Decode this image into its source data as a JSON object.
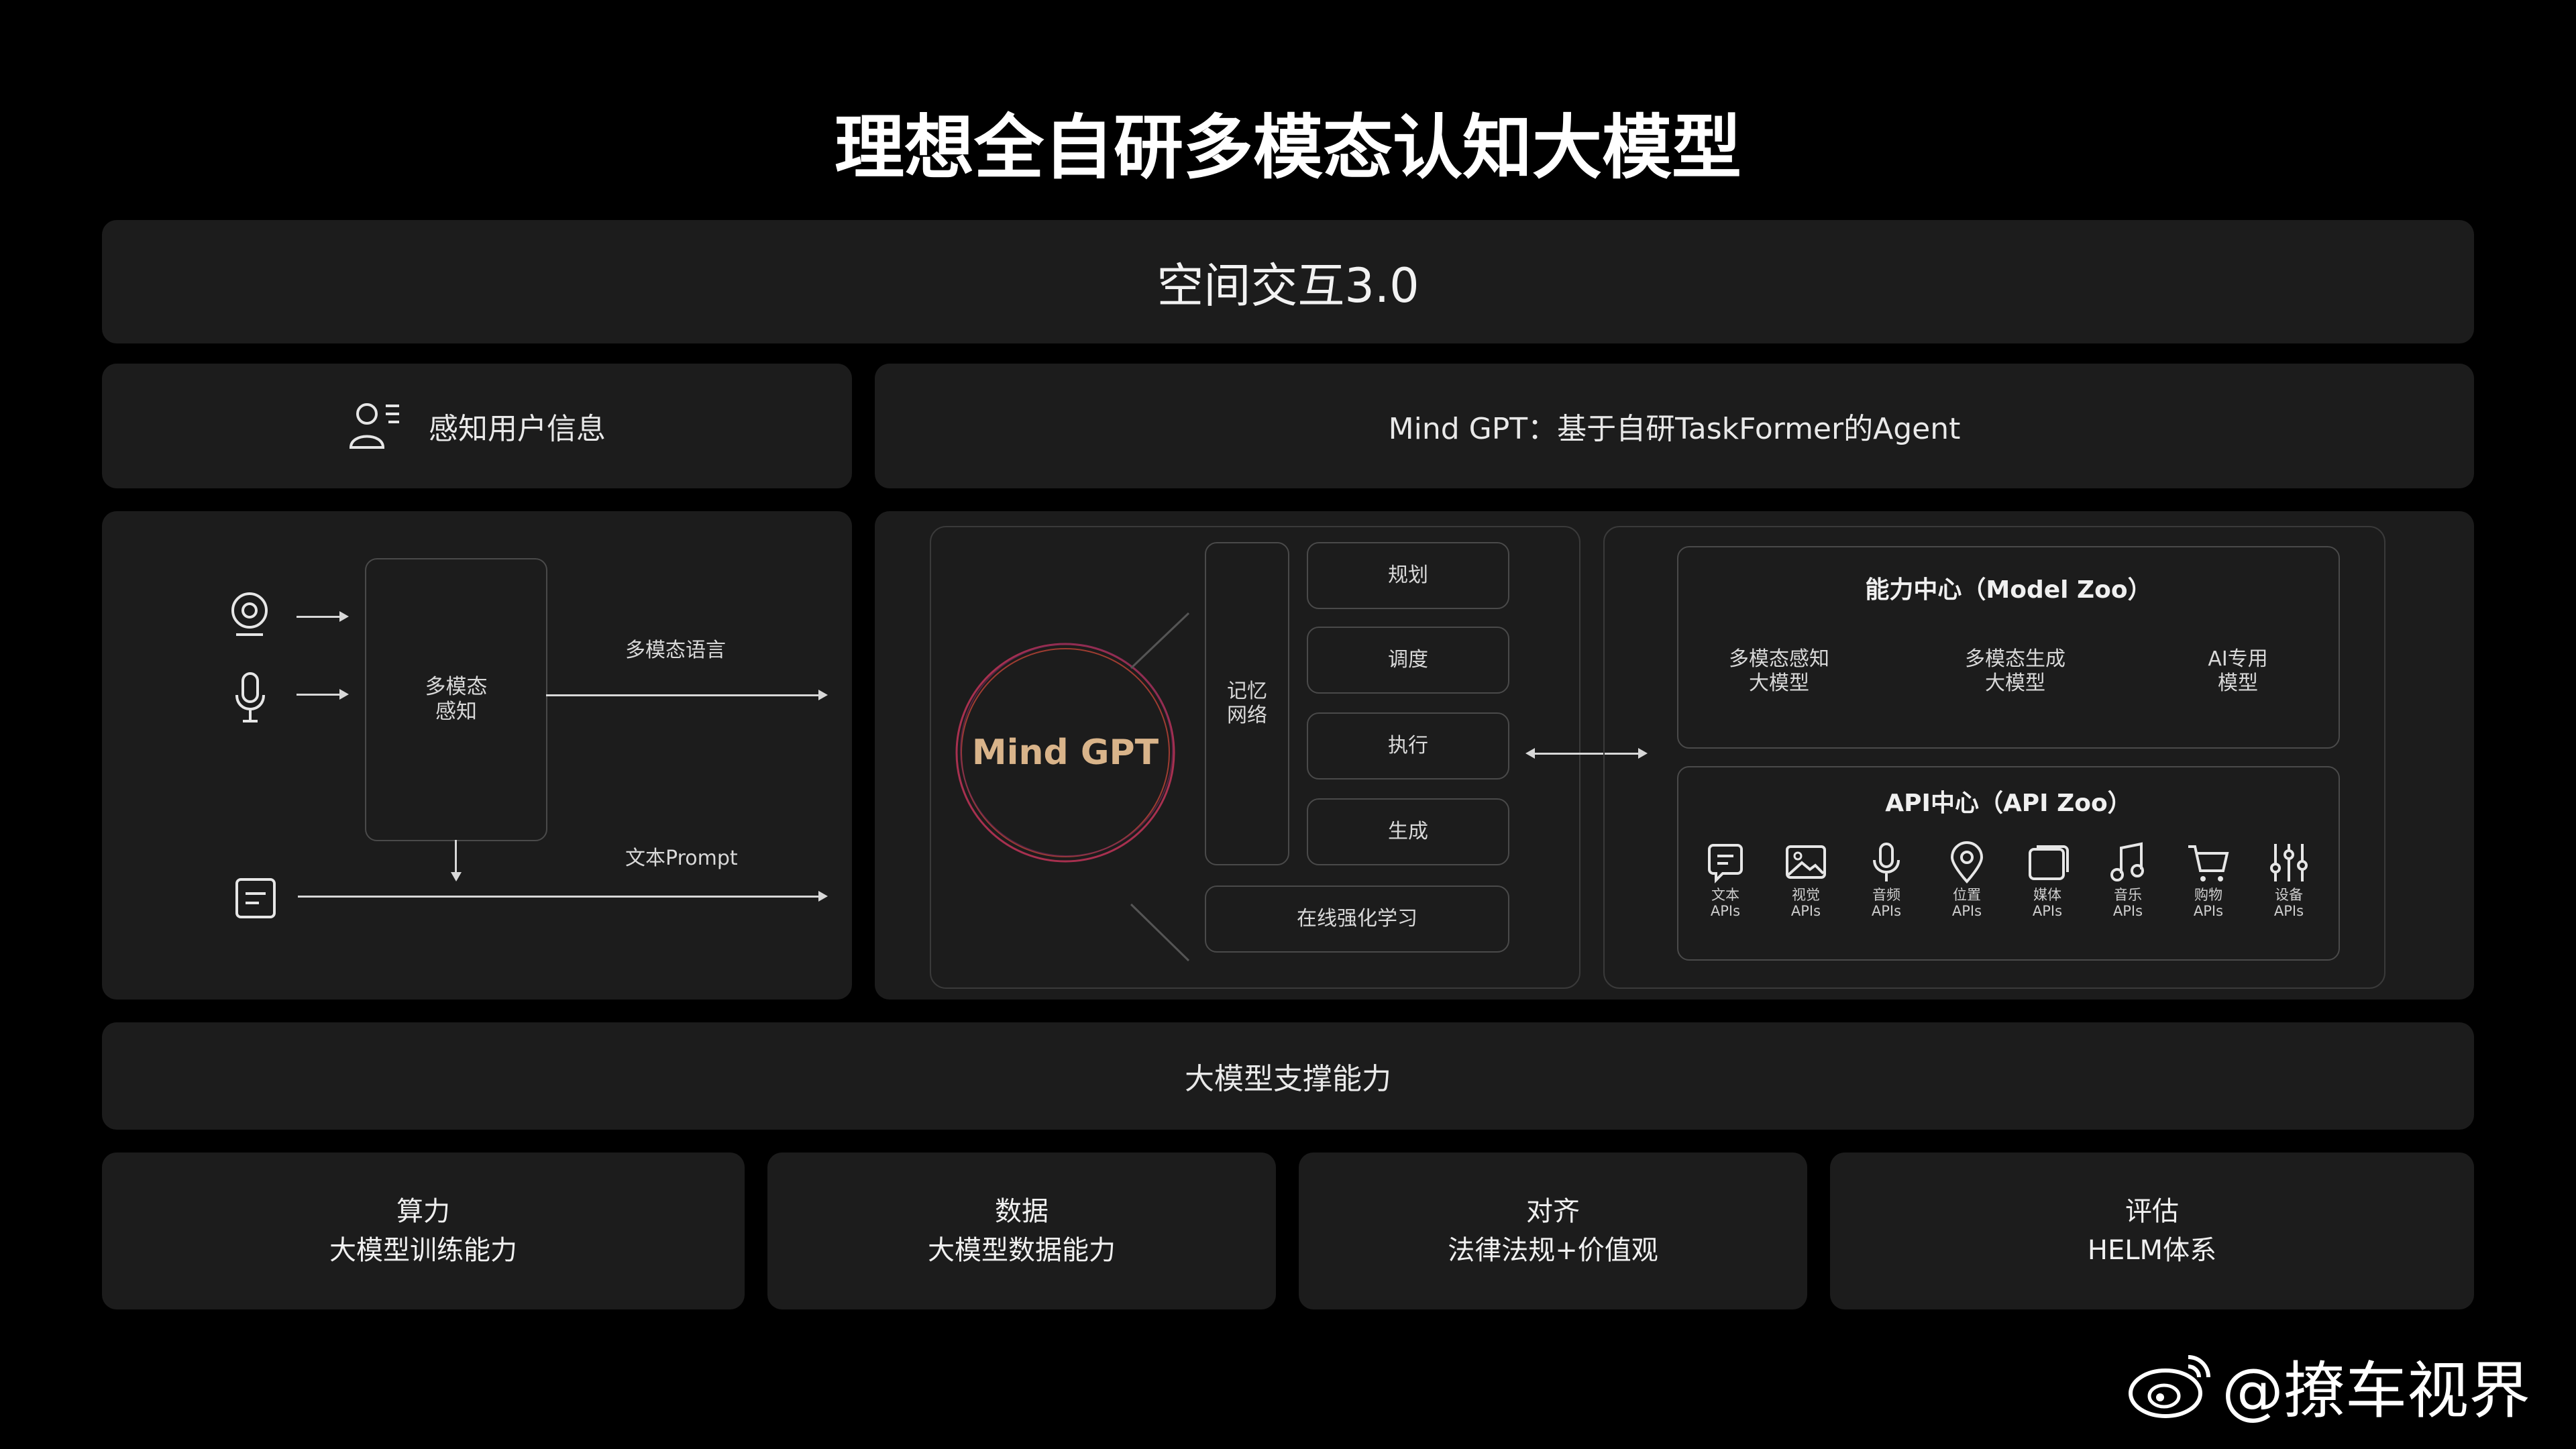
{
  "title": "理想全自研多模态认知大模型",
  "row1": {
    "label": "空间交互3.0"
  },
  "row2": {
    "left_label": "感知用户信息",
    "right_label": "Mind GPT：基于自研TaskFormer的Agent"
  },
  "perception": {
    "box_label_line1": "多模态",
    "box_label_line2": "感知",
    "arrow_top_label": "多模态语言",
    "arrow_bottom_label": "文本Prompt"
  },
  "mindgpt": {
    "circle_label": "Mind GPT",
    "memory_line1": "记忆",
    "memory_line2": "网络",
    "steps": [
      "规划",
      "调度",
      "执行",
      "生成"
    ],
    "online_learning": "在线强化学习"
  },
  "capability": {
    "title": "能力中心（Model Zoo）",
    "items": [
      {
        "line1": "多模态感知",
        "line2": "大模型"
      },
      {
        "line1": "多模态生成",
        "line2": "大模型"
      },
      {
        "line1": "AI专用",
        "line2": "模型"
      }
    ]
  },
  "api": {
    "title": "API中心（API Zoo）",
    "items": [
      {
        "line1": "文本",
        "line2": "APIs",
        "icon": "chat-icon"
      },
      {
        "line1": "视觉",
        "line2": "APIs",
        "icon": "image-icon"
      },
      {
        "line1": "音频",
        "line2": "APIs",
        "icon": "microphone-icon"
      },
      {
        "line1": "位置",
        "line2": "APIs",
        "icon": "location-pin-icon"
      },
      {
        "line1": "媒体",
        "line2": "APIs",
        "icon": "media-icon"
      },
      {
        "line1": "音乐",
        "line2": "APIs",
        "icon": "music-note-icon"
      },
      {
        "line1": "购物",
        "line2": "APIs",
        "icon": "shopping-cart-icon"
      },
      {
        "line1": "设备",
        "line2": "APIs",
        "icon": "sliders-icon"
      }
    ]
  },
  "support": {
    "label": "大模型支撑能力"
  },
  "bottom": [
    {
      "line1": "算力",
      "line2": "大模型训练能力"
    },
    {
      "line1": "数据",
      "line2": "大模型数据能力"
    },
    {
      "line1": "对齐",
      "line2": "法律法规+价值观"
    },
    {
      "line1": "评估",
      "line2": "HELM体系"
    }
  ],
  "watermark": {
    "text": "@撩车视界"
  },
  "colors": {
    "background": "#000000",
    "panel": "#1c1c1c",
    "mindgpt_text": "#d9b48a",
    "ring": "#c2395a"
  }
}
